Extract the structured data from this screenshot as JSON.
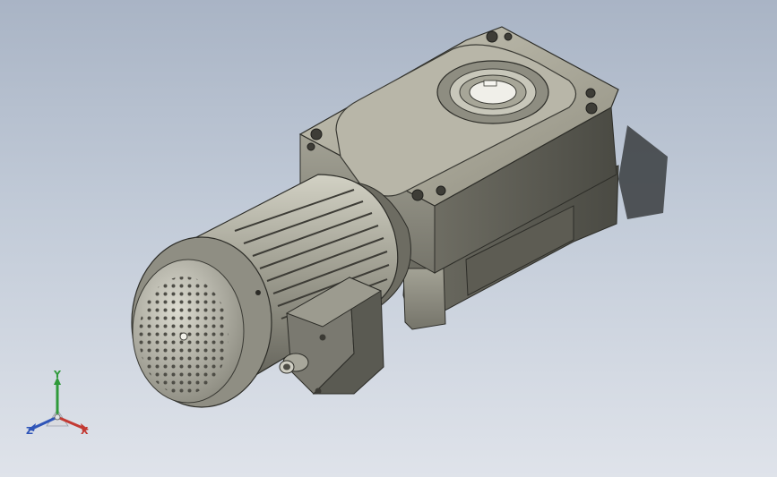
{
  "viewport": {
    "background_top": "#a9b4c5",
    "background_bottom": "#dfe3ea",
    "model_name": ""
  },
  "triad": {
    "x_label": "X",
    "y_label": "Y",
    "z_label": "Z",
    "x_color": "#c33a33",
    "y_color": "#2f9a3a",
    "z_color": "#2f55b8"
  }
}
